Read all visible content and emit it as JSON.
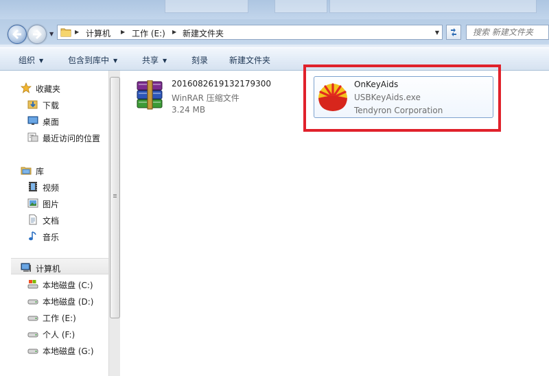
{
  "address": {
    "breadcrumbs": [
      "计算机",
      "工作 (E:)",
      "新建文件夹"
    ]
  },
  "search": {
    "placeholder": "搜索 新建文件夹"
  },
  "toolbar": {
    "organize": "组织",
    "include_library": "包含到库中",
    "share": "共享",
    "burn": "刻录",
    "new_folder": "新建文件夹"
  },
  "nav": {
    "favorites": {
      "label": "收藏夹",
      "items": [
        "下载",
        "桌面",
        "最近访问的位置"
      ]
    },
    "libraries": {
      "label": "库",
      "items": [
        "视频",
        "图片",
        "文档",
        "音乐"
      ]
    },
    "computer": {
      "label": "计算机",
      "items": [
        "本地磁盘 (C:)",
        "本地磁盘 (D:)",
        "工作 (E:)",
        "个人 (F:)",
        "本地磁盘 (G:)"
      ]
    }
  },
  "files": [
    {
      "name": "2016082619132179300",
      "type": "WinRAR 压缩文件",
      "size": "3.24 MB",
      "icon": "winrar-archive-icon"
    },
    {
      "name": "OnKeyAids",
      "filename": "USBKeyAids.exe",
      "publisher": "Tendyron Corporation",
      "icon": "petrochina-logo-icon"
    }
  ],
  "colors": {
    "highlight": "#e0212b",
    "selection_border": "#7da2ce"
  }
}
